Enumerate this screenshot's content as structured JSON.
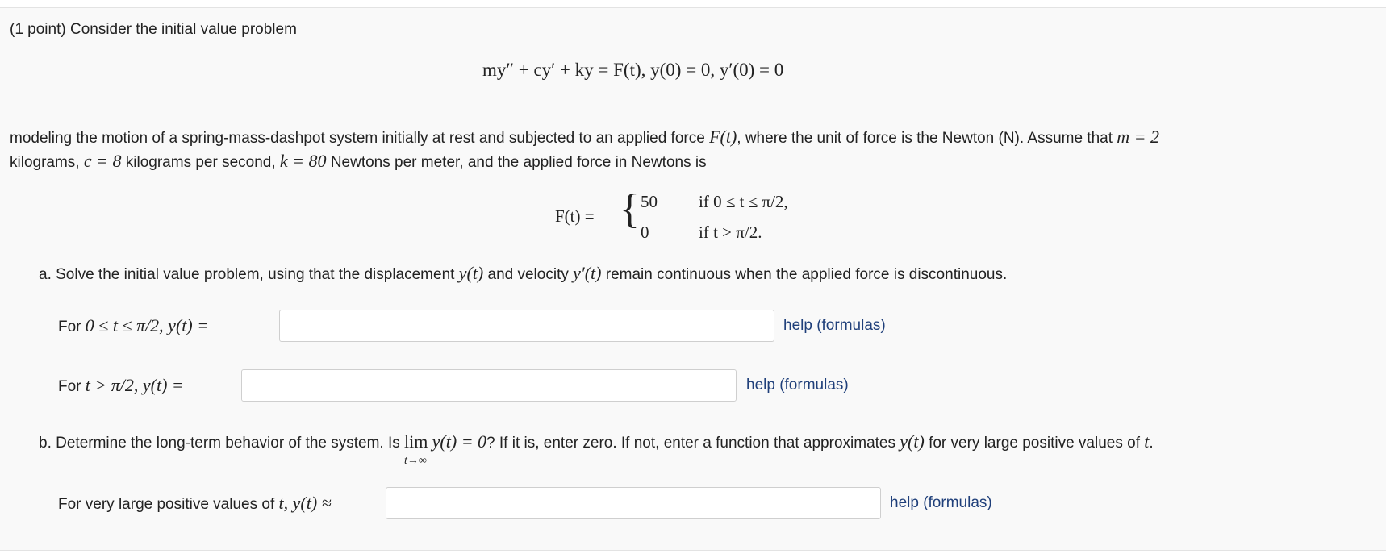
{
  "header": {
    "points": "(1 point)",
    "intro": "Consider the initial value problem"
  },
  "ivp_equation": "my″ + cy′ + ky = F(t),   y(0) = 0,   y′(0) = 0",
  "description": {
    "line1_a": "modeling the motion of a spring-mass-dashpot system initially at rest and subjected to an applied force",
    "line1_force": "F(t)",
    "line1_b": ", where the unit of force is the Newton (N). Assume that",
    "m_expr": "m = 2",
    "line2_a": "kilograms,",
    "c_expr": "c = 8",
    "line2_b": "kilograms per second,",
    "k_expr": "k = 80",
    "line2_c": "Newtons per meter, and the applied force in Newtons is"
  },
  "piecewise": {
    "lhs": "F(t) =",
    "case1_value": "50",
    "case1_condition": "if 0 ≤ t ≤ π/2,",
    "case2_value": "0",
    "case2_condition": "if t > π/2."
  },
  "part_a": {
    "text_a": "a. Solve the initial value problem, using that the displacement",
    "y_t": "y(t)",
    "text_b": "and velocity",
    "yprime_t": "y′(t)",
    "text_c": "remain continuous when the applied force is discontinuous.",
    "row1_prefix": "For",
    "row1_math": "0 ≤ t ≤ π/2,  y(t) =",
    "row1_value": "",
    "row2_prefix": "For",
    "row2_math": "t > π/2,  y(t) =",
    "row2_value": ""
  },
  "part_b": {
    "text_a": "b. Determine the long-term behavior of the system. Is",
    "lim": "lim",
    "lim_sub": "t→∞",
    "lim_expr": "y(t) = 0",
    "text_b": "? If it is, enter zero. If not, enter a function that approximates",
    "y_t": "y(t)",
    "text_c": "for very large positive values of",
    "t_var": "t",
    "period": ".",
    "row_prefix": "For very large positive values of",
    "row_t": "t",
    "row_math": ", y(t) ≈",
    "row_value": ""
  },
  "help_label": "help (formulas)"
}
